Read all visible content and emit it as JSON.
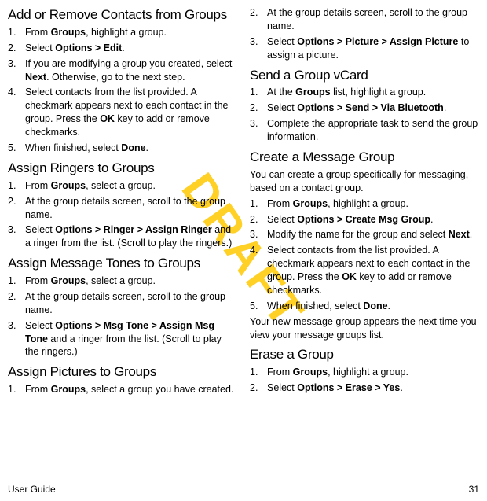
{
  "watermark": "DRAFT",
  "footer": {
    "left": "User Guide",
    "right": "31"
  },
  "left": {
    "sec1": {
      "title": "Add or Remove Contacts from Groups",
      "i1": {
        "a": "From ",
        "b": "Groups",
        "c": ", highlight a group."
      },
      "i2": {
        "a": "Select ",
        "b": "Options > Edit",
        "c": "."
      },
      "i3": {
        "a": "If you are modifying a group you created, select ",
        "b": "Next",
        "c": ". Otherwise, go to the next step."
      },
      "i4": {
        "a": "Select contacts from the list provided. A checkmark appears next to each contact in the group. Press the ",
        "b": "OK",
        "c": " key to add or remove checkmarks."
      },
      "i5": {
        "a": "When finished, select ",
        "b": "Done",
        "c": "."
      }
    },
    "sec2": {
      "title": "Assign Ringers to Groups",
      "i1": {
        "a": "From ",
        "b": "Groups",
        "c": ", select a group."
      },
      "i2": "At the group details screen, scroll to the group name.",
      "i3": {
        "a": "Select ",
        "b": "Options > Ringer > Assign Ringer",
        "c": " and a ringer from the list. (Scroll to play the ringers.)"
      }
    },
    "sec3": {
      "title": "Assign Message Tones to Groups",
      "i1": {
        "a": "From ",
        "b": "Groups",
        "c": ", select a group."
      },
      "i2": "At the group details screen, scroll to the group name.",
      "i3": {
        "a": "Select ",
        "b": "Options > Msg Tone > Assign Msg Tone",
        "c": " and a ringer from the list. (Scroll to play the ringers.)"
      }
    },
    "sec4": {
      "title": "Assign Pictures to Groups",
      "i1": {
        "a": "From ",
        "b": "Groups",
        "c": ", select a group you have created."
      }
    }
  },
  "right": {
    "sec4cont": {
      "i2": "At the group details screen, scroll to the group name.",
      "i3": {
        "a": "Select ",
        "b": "Options > Picture > Assign Picture",
        "c": " to assign a picture."
      }
    },
    "sec5": {
      "title": "Send a Group vCard",
      "i1": {
        "a": "At the ",
        "b": "Groups",
        "c": " list, highlight a group."
      },
      "i2": {
        "a": "Select ",
        "b": "Options > Send > Via Bluetooth",
        "c": "."
      },
      "i3": "Complete the appropriate task to send the group information."
    },
    "sec6": {
      "title": "Create a Message Group",
      "intro": "You can create a group specifically for messaging, based on a contact group.",
      "i1": {
        "a": "From ",
        "b": "Groups",
        "c": ", highlight a group."
      },
      "i2": {
        "a": "Select ",
        "b": "Options > Create Msg Group",
        "c": "."
      },
      "i3": {
        "a": "Modify the name for the group and select ",
        "b": "Next",
        "c": "."
      },
      "i4": {
        "a": "Select contacts from the list provided. A checkmark appears next to each contact in the group. Press the ",
        "b": "OK",
        "c": " key to add or remove checkmarks."
      },
      "i5": {
        "a": "When finished, select ",
        "b": "Done",
        "c": "."
      },
      "outro": "Your new message group appears the next time you view your message groups list."
    },
    "sec7": {
      "title": "Erase a Group",
      "i1": {
        "a": "From ",
        "b": "Groups",
        "c": ", highlight a group."
      },
      "i2": {
        "a": "Select ",
        "b": "Options > Erase > Yes",
        "c": "."
      }
    }
  }
}
